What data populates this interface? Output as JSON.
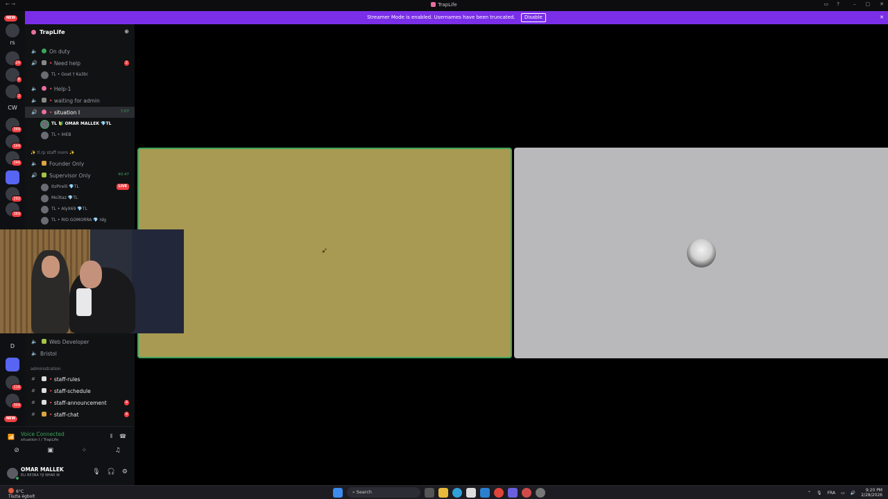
{
  "window": {
    "title": "TrapLife"
  },
  "banner": {
    "message": "Streamer Mode is enabled. Usernames have been truncated.",
    "disable_label": "Disable"
  },
  "servers": {
    "new_label": "NEW",
    "items": [
      {
        "label": "rs"
      },
      {
        "badge": "24"
      },
      {
        "badge": "8"
      },
      {
        "badge": "3"
      },
      {
        "label": "CW"
      },
      {
        "badge": "368"
      },
      {
        "badge": "144"
      },
      {
        "badge": "346"
      },
      {
        "badge": "292"
      },
      {
        "badge": "369"
      },
      {
        "label": "D"
      },
      {
        "badge": "116"
      },
      {
        "badge": "304"
      }
    ]
  },
  "guild": {
    "name": "TrapLife"
  },
  "channels": [
    {
      "label": "On duty",
      "type": "voice"
    },
    {
      "label": "Need help",
      "type": "voice",
      "count": "2",
      "live": true
    },
    {
      "label": "Help-1",
      "type": "voice"
    },
    {
      "label": "waiting for admin",
      "type": "voice"
    },
    {
      "label": "situation I",
      "type": "voice",
      "time": "7:07",
      "selected": true
    },
    {
      "label": "Founder Only",
      "type": "voice"
    },
    {
      "label": "Supervisor Only",
      "type": "voice",
      "time": "40:47",
      "live": true
    },
    {
      "label": "Web Developer",
      "type": "voice"
    },
    {
      "label": "Bristol",
      "type": "voice"
    },
    {
      "label": "staff-rules",
      "type": "text"
    },
    {
      "label": "staff-schedule",
      "type": "text"
    },
    {
      "label": "staff-announcement",
      "type": "text",
      "count": "4"
    },
    {
      "label": "staff-chat",
      "type": "text",
      "count": "4"
    }
  ],
  "voice_users": {
    "need_help": [
      {
        "name": "TL • Goat † Ka3bi"
      }
    ],
    "situation": [
      {
        "name": "TL 🔰 OMAR MALLEK 💎TL",
        "speaking": true
      },
      {
        "name": "TL • IHEB"
      }
    ],
    "supervisor": [
      {
        "name": "ItsPirelli 💎TL",
        "live": "LIVE"
      },
      {
        "name": "Mo3taz 💎TL"
      },
      {
        "name": "TL • AlyX69 💎TL"
      },
      {
        "name": "TL • RIO GOMORRA 💎 Idg"
      }
    ]
  },
  "categories": {
    "staff_room": "✨ tl.rp staff room ✨",
    "administration": "administration"
  },
  "voice_status": {
    "title": "Voice Connected",
    "subtitle": "situation I / TrapLife"
  },
  "user": {
    "name": "OMAR MALLEK",
    "status": "ELI BE3NA YJI NHAR W"
  },
  "taskbar": {
    "temperature": "6°C",
    "weather": "Tiszta égbolt",
    "search_placeholder": "Search",
    "language": "FRA",
    "time": "9:20 PM",
    "date": "2/28/2026"
  },
  "colors": {
    "banner": "#7a2ee8",
    "stage_left": "#a89a52",
    "stage_right": "#b9b8bb",
    "speaking": "#3ba55d",
    "badge": "#f23f42"
  }
}
